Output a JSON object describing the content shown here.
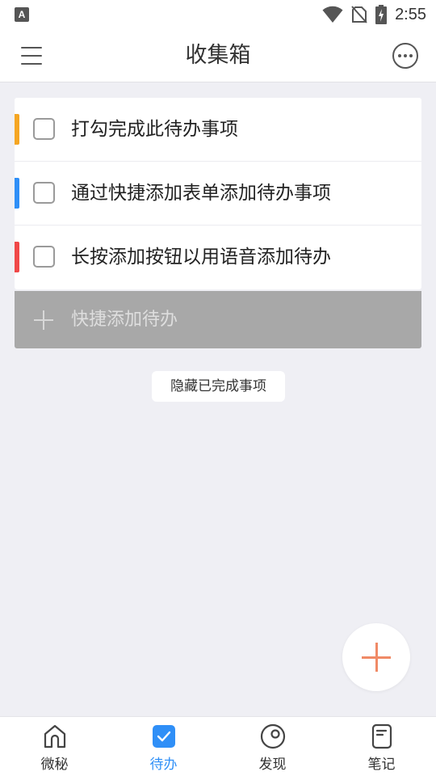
{
  "status_bar": {
    "app_icon_letter": "A",
    "time": "2:55",
    "icons": [
      "wifi-icon",
      "no-sim-icon",
      "battery-charging-icon"
    ]
  },
  "header": {
    "title": "收集箱",
    "menu_icon": "menu-icon",
    "more_icon": "more-icon"
  },
  "todos": [
    {
      "text": "打勾完成此待办事项",
      "priority_color": "#f5a623",
      "checked": false
    },
    {
      "text": "通过快捷添加表单添加待办事项",
      "priority_color": "#2f8ff7",
      "checked": false
    },
    {
      "text": "长按添加按钮以用语音添加待办",
      "priority_color": "#f04848",
      "checked": false
    }
  ],
  "quick_add": {
    "placeholder": "快捷添加待办",
    "icon": "plus-icon"
  },
  "hide_completed_label": "隐藏已完成事项",
  "fab": {
    "icon": "plus-icon",
    "color": "#f08a66"
  },
  "bottom_nav": {
    "active_color": "#2f8ff7",
    "tabs": [
      {
        "label": "微秘",
        "icon": "home-icon",
        "active": false
      },
      {
        "label": "待办",
        "icon": "checkbox-icon",
        "active": true
      },
      {
        "label": "发现",
        "icon": "compass-icon",
        "active": false
      },
      {
        "label": "笔记",
        "icon": "note-icon",
        "active": false
      }
    ]
  }
}
